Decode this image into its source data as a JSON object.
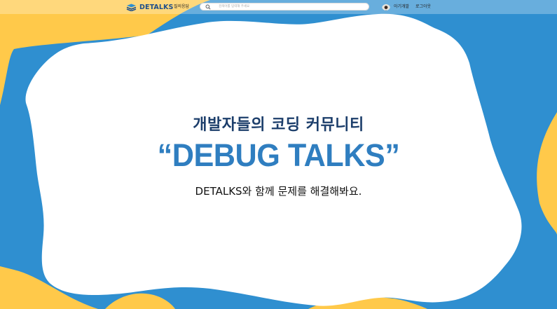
{
  "colors": {
    "yellow": "#ffc94a",
    "blue": "#2f8fd0",
    "white": "#ffffff",
    "title_blue": "#2f7ec0",
    "heading_navy": "#1c3e6b",
    "logo_navy": "#1f4f8a"
  },
  "navbar": {
    "logo_text": "DETALKS",
    "logo_icon": "chat-bubbles-icon",
    "menu_label": "질의응답",
    "search": {
      "placeholder": "검색어를 입력해 주세요",
      "value": ""
    },
    "username": "아기개발",
    "logout_label": "로그아웃"
  },
  "hero": {
    "subtitle": "개발자들의 코딩 커뮤니티",
    "title": "“DEBUG TALKS”",
    "description": "DETALKS와 함께 문제를 해결해봐요."
  }
}
